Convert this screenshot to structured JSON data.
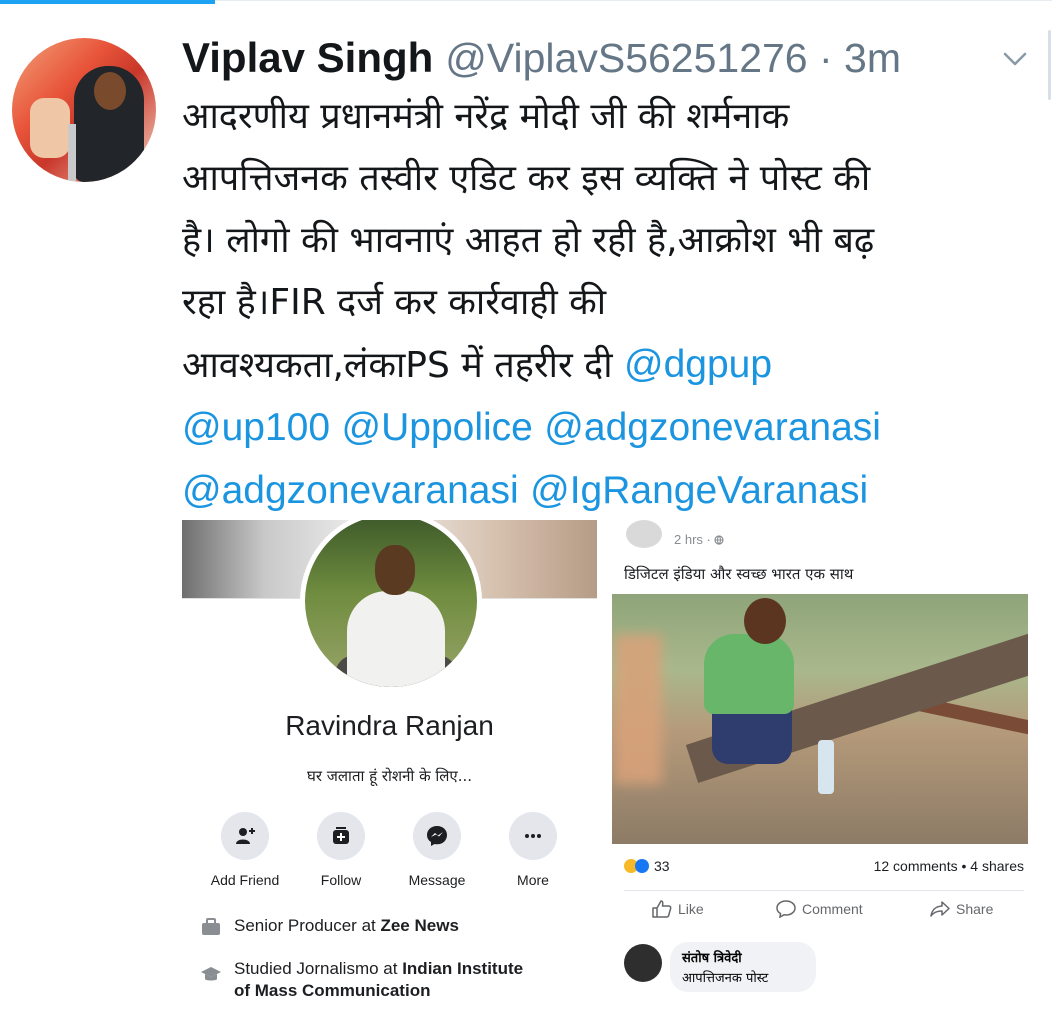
{
  "tweet": {
    "author_name": "Viplav Singh",
    "handle_time": "@ViplavS56251276 · 3m",
    "text_lines": [
      "आदरणीय प्रधानमंत्री नरेंद्र मोदी जी की शर्मनाक",
      "आपत्तिजनक तस्वीर एडिट कर इस व्यक्ति ने पोस्ट की",
      "है। लोगो की भावनाएं आहत हो रही है,आक्रोश भी बढ़",
      "रहा है।FIR दर्ज कर कार्रवाही की"
    ],
    "line5_text": "आवश्यकता,लंकाPS में तहरीर दी ",
    "mentions": [
      "@dgpup",
      "@up100",
      "@Uppolice",
      "@adgzonevaranasi",
      "@adgzonevaranasi",
      "@IgRangeVaranasi"
    ],
    "menu_icon": "chevron-down-icon"
  },
  "profile_card": {
    "name": "Ravindra Ranjan",
    "bio": "घर जलाता हूं रोशनी के लिए...",
    "actions": [
      {
        "label": "Add Friend",
        "icon": "add-friend-icon"
      },
      {
        "label": "Follow",
        "icon": "follow-icon"
      },
      {
        "label": "Message",
        "icon": "messenger-icon"
      },
      {
        "label": "More",
        "icon": "more-icon"
      }
    ],
    "work_prefix": "Senior Producer at ",
    "work_org": "Zee News",
    "edu_prefix": "Studied Jornalismo at ",
    "edu_org_line1": "Indian Institute",
    "edu_org_line2": "of Mass Communication"
  },
  "post_card": {
    "time": "2 hrs · ",
    "text": "डिजिटल इंडिया और स्वच्छ भारत एक साथ",
    "reaction_count": "33",
    "comments_shares": "12 comments • 4 shares",
    "buttons": [
      "Like",
      "Comment",
      "Share"
    ],
    "comment_author": "संतोष त्रिवेदी",
    "comment_text": "आपत्तिजनक पोस्ट"
  },
  "colors": {
    "accent": "#1da1f2",
    "mention": "#1b95e0",
    "handle_gray": "#657786"
  }
}
